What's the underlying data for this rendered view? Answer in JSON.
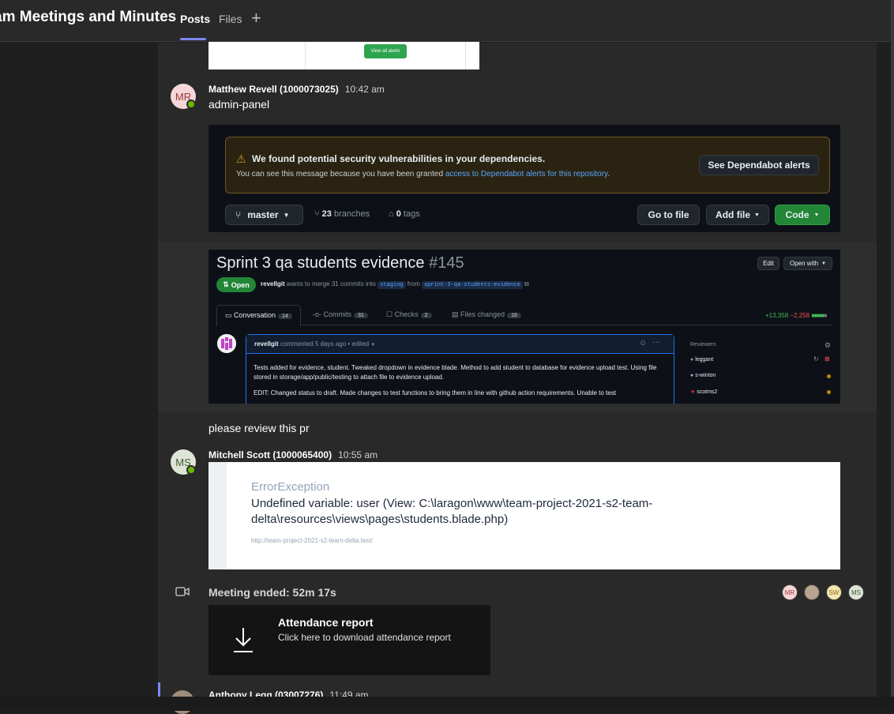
{
  "header": {
    "channel_title": "am Meetings and Minutes",
    "tabs": [
      {
        "label": "Posts",
        "active": true
      },
      {
        "label": "Files",
        "active": false
      }
    ],
    "add_tab_icon": "plus-icon"
  },
  "snippet_top": {
    "button_label": "View all alerts"
  },
  "post1": {
    "avatar_initials": "MR",
    "author": "Matthew Revell (1000073025)",
    "time": "10:42 am",
    "message": "admin-panel"
  },
  "github_repo": {
    "alert_title": "We found potential security vulnerabilities in your dependencies.",
    "alert_text": "You can see this message because you have been granted",
    "alert_link": "access to Dependabot alerts for this repository",
    "alert_tail": ".",
    "alert_button": "See Dependabot alerts",
    "branch": "master",
    "branches_count": "23",
    "branches_label": "branches",
    "tags_count": "0",
    "tags_label": "tags",
    "go_to_file": "Go to file",
    "add_file": "Add file",
    "code": "Code"
  },
  "github_pr": {
    "title": "Sprint 3 qa students evidence",
    "number": "#145",
    "status": "Open",
    "author": "revellgit",
    "merge_text": "wants to merge 31 commits into",
    "base_branch": "staging",
    "from_text": "from",
    "head_branch": "sprint-3-qa-students-evidence",
    "edit_btn": "Edit",
    "open_with_btn": "Open with",
    "tabs": [
      {
        "label": "Conversation",
        "count": "14"
      },
      {
        "label": "Commits",
        "count": "31"
      },
      {
        "label": "Checks",
        "count": "2"
      },
      {
        "label": "Files changed",
        "count": "16"
      }
    ],
    "additions": "+13,358",
    "deletions": "−2,258",
    "comment_author": "revellgit",
    "comment_meta": "commented 5 days ago • edited",
    "comment_p1": "Tests added for evidence, student. Tweaked dropdown in evidence blade. Method to add student to database for evidence upload test. Using file stored in storage/app/public/testing to attach file to evidence upload.",
    "comment_p2": "EDIT: Changed status to draft. Made changes to test functions to bring them in line with github action requirements. Unable to test",
    "reviewers_label": "Reviewers",
    "reviewers": [
      "leggant",
      "s-winton",
      "scotms2"
    ]
  },
  "message_review": "please review this pr",
  "post2": {
    "avatar_initials": "MS",
    "author": "Mitchell Scott (1000065400)",
    "time": "10:55 am"
  },
  "error_page": {
    "type": "ErrorException",
    "message": "Undefined variable: user (View: C:\\laragon\\www\\team-project-2021-s2-team-delta\\resources\\views\\pages\\students.blade.php)",
    "url": "http://team-project-2021-s2-team-delta.test/"
  },
  "meeting": {
    "title": "Meeting ended: 52m 17s",
    "participants": [
      "MR",
      "",
      "SW",
      "MS"
    ],
    "report_title": "Attendance report",
    "report_sub": "Click here to download attendance report"
  },
  "post3": {
    "author": "Anthony Legg (03007276)",
    "time": "11:49 am"
  },
  "colors": {
    "accent": "#7f85f5",
    "presence": "#6bb700",
    "github_green": "#238636"
  }
}
